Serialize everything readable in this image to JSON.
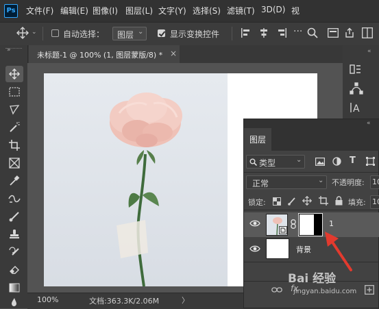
{
  "app": {
    "logo": "Ps"
  },
  "menu": [
    "文件(F)",
    "编辑(E)",
    "图像(I)",
    "图层(L)",
    "文字(Y)",
    "选择(S)",
    "滤镜(T)",
    "3D(D)",
    "视"
  ],
  "options_bar": {
    "auto_select_label": "自动选择：",
    "auto_select_checked": false,
    "target_dropdown": "图层",
    "show_transform_label": "显示变换控件",
    "show_transform_checked": true
  },
  "document_tab": {
    "title": "未标题-1 @ 100% (1, 图层蒙版/8) *",
    "close": "×"
  },
  "status_bar": {
    "zoom": "100%",
    "doc_info": "文档:363.3K/2.06M",
    "arrow": "〉"
  },
  "layers_panel": {
    "tab_label": "图层",
    "filter_kind": "类型",
    "blend_mode": "正常",
    "opacity_label": "不透明度:",
    "opacity_value": "10",
    "lock_label": "锁定:",
    "fill_label": "填充:",
    "fill_value": "10",
    "layers": [
      {
        "name": "1",
        "selected": true,
        "has_mask": true
      },
      {
        "name": "背景",
        "selected": false,
        "has_mask": false
      }
    ],
    "bottom_text": "fx"
  },
  "watermark": {
    "text": "Bai 经验",
    "url": "jingyan.baidu.com"
  },
  "colors": {
    "accent_blue": "#31a8ff",
    "arrow_red": "#e23a2e",
    "photo_bg": "#dfe4ea"
  }
}
